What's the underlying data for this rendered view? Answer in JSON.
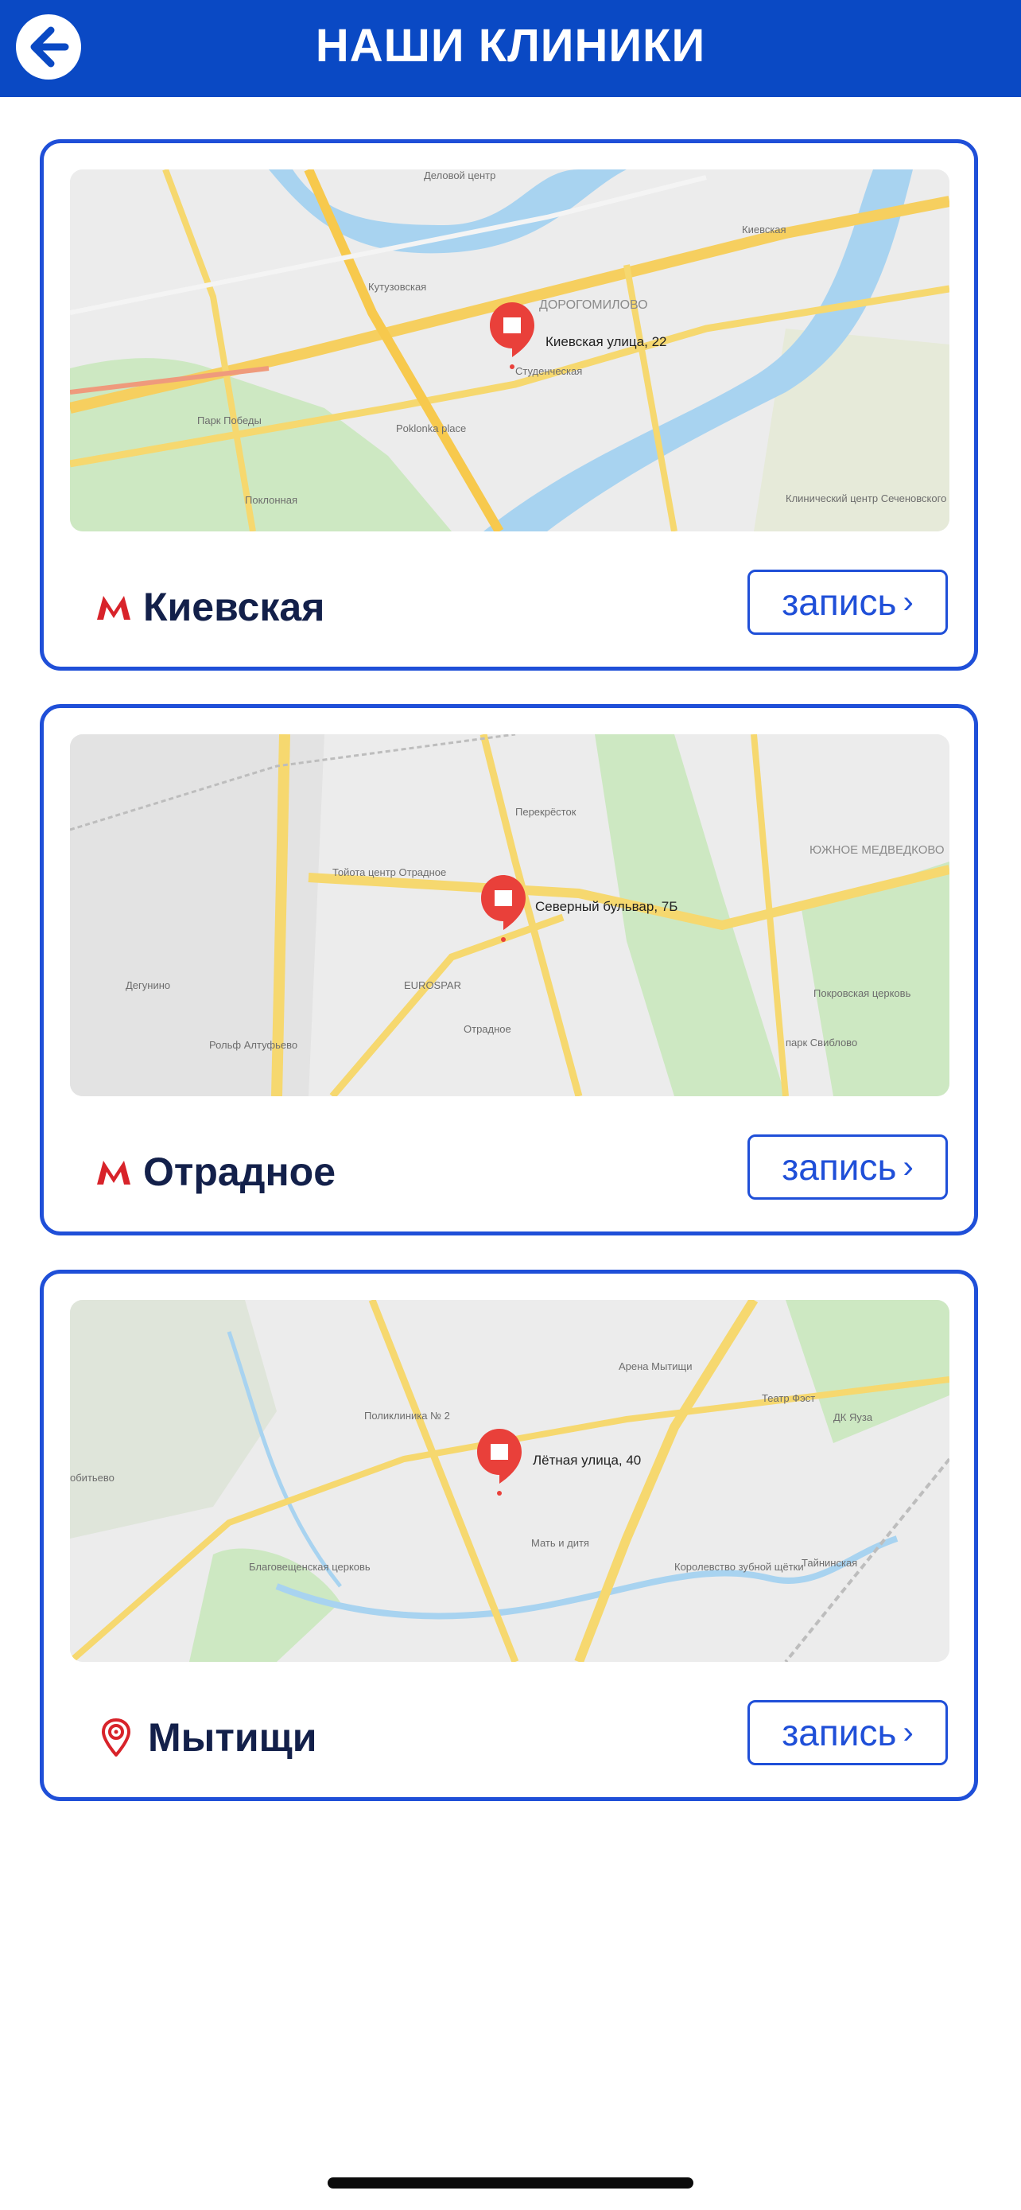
{
  "header": {
    "title": "НАШИ КЛИНИКИ",
    "back_icon": "arrow-left-icon"
  },
  "clinics": [
    {
      "station": "Киевская",
      "station_icon": "metro-icon",
      "address": "Киевская улица, 22",
      "button_label": "запись",
      "map_labels": [
        "Деловой центр",
        "Кутузовская",
        "ДОРОГОМИЛОВО",
        "Студенческая",
        "Киевская",
        "Парк Победы",
        "Poklonka place",
        "Клинический центр Сеченовского",
        "Поклонная"
      ]
    },
    {
      "station": "Отрадное",
      "station_icon": "metro-icon",
      "address": "Северный бульвар, 7Б",
      "button_label": "запись",
      "map_labels": [
        "Перекрёсток",
        "Тойота центр Отрадное",
        "ЮЖНОЕ МЕДВЕДКОВО",
        "EUROSPAR",
        "Отрадное",
        "Дегунино",
        "Рольф Алтуфьево",
        "Покровская церковь",
        "парк Свиблово"
      ]
    },
    {
      "station": "Мытищи",
      "station_icon": "location-pin-icon",
      "address": "Лётная улица, 40",
      "button_label": "запись",
      "map_labels": [
        "Арена Мытищи",
        "Поликлиника № 2",
        "Театр Фэст",
        "ДК Яуза",
        "Мать и дитя",
        "Благовещенская церковь",
        "Королевство зубной щётки",
        "Тайнинская"
      ]
    }
  ],
  "colors": {
    "header_bg": "#0a49c4",
    "accent": "#1f4fd8",
    "metro_red": "#d8232a",
    "title_dark": "#13204a"
  }
}
